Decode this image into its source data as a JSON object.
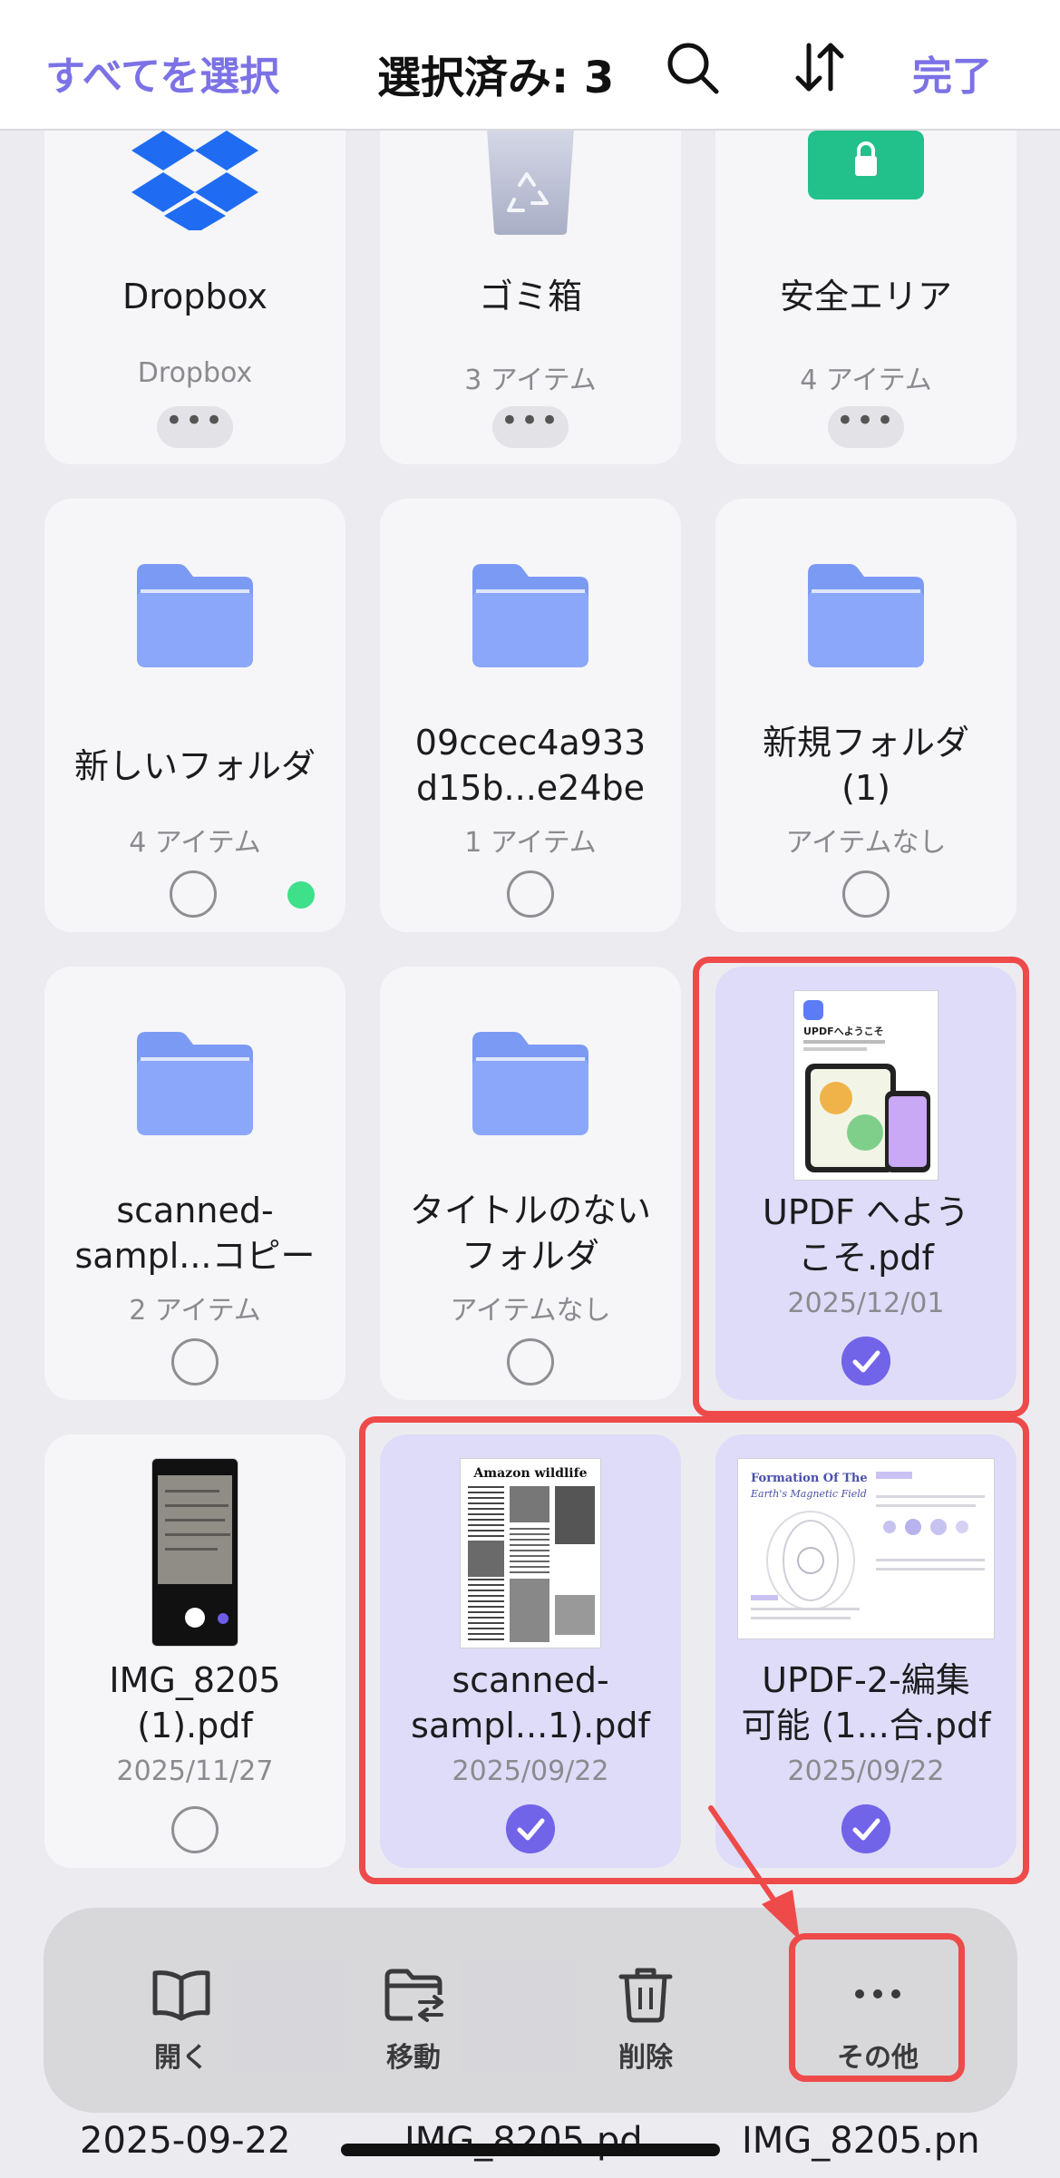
{
  "header": {
    "select_all": "すべてを選択",
    "title": "選択済み: 3",
    "done": "完了",
    "search_icon": "search-icon",
    "sort_icon": "sort-icon"
  },
  "items": [
    {
      "name": "Dropbox",
      "sub": "Dropbox",
      "type": "dropbox",
      "state": "more"
    },
    {
      "name": "ゴミ箱",
      "sub": "3 アイテム",
      "type": "trash",
      "state": "more"
    },
    {
      "name": "安全エリア",
      "sub": "4 アイテム",
      "type": "safe",
      "state": "more"
    },
    {
      "name": "新しいフォルダ",
      "sub": "4 アイテム",
      "type": "folder",
      "state": "unselected",
      "badge": "new-dot"
    },
    {
      "name": "09ccec4a933\nd15b...e24be",
      "sub": "1 アイテム",
      "type": "folder",
      "state": "unselected"
    },
    {
      "name": "新規フォルダ\n(1)",
      "sub": "アイテムなし",
      "type": "folder",
      "state": "unselected"
    },
    {
      "name": "scanned-\nsampl...コピー",
      "sub": "2 アイテム",
      "type": "folder",
      "state": "unselected"
    },
    {
      "name": "タイトルのない\nフォルダ",
      "sub": "アイテムなし",
      "type": "folder",
      "state": "unselected"
    },
    {
      "name": "UPDF へよう\nこそ.pdf",
      "sub": "2025/12/01",
      "type": "pdf-updf",
      "state": "selected",
      "thumb_title": "UPDFへようこそ"
    },
    {
      "name": "IMG_8205\n(1).pdf",
      "sub": "2025/11/27",
      "type": "pdf-phone",
      "state": "unselected"
    },
    {
      "name": "scanned-\nsampl...1).pdf",
      "sub": "2025/09/22",
      "type": "pdf-wildlife",
      "state": "selected",
      "thumb_title": "Amazon wildlife"
    },
    {
      "name": "UPDF-2-編集\n可能 (1...合.pdf",
      "sub": "2025/09/22",
      "type": "pdf-magnetic",
      "state": "selected",
      "thumb_title": "Formation Of The",
      "thumb_subtitle": "Earth's Magnetic Field"
    }
  ],
  "toolbar": {
    "open": "開く",
    "move": "移動",
    "delete": "削除",
    "more": "その他"
  },
  "peek": [
    "2025-09-22",
    "IMG_8205.pd",
    "IMG_8205.pn"
  ],
  "colors": {
    "accent": "#7c72e6",
    "selected_bg": "#dedcf8",
    "highlight": "#ef4a4a",
    "folder": "#7b9af4"
  }
}
